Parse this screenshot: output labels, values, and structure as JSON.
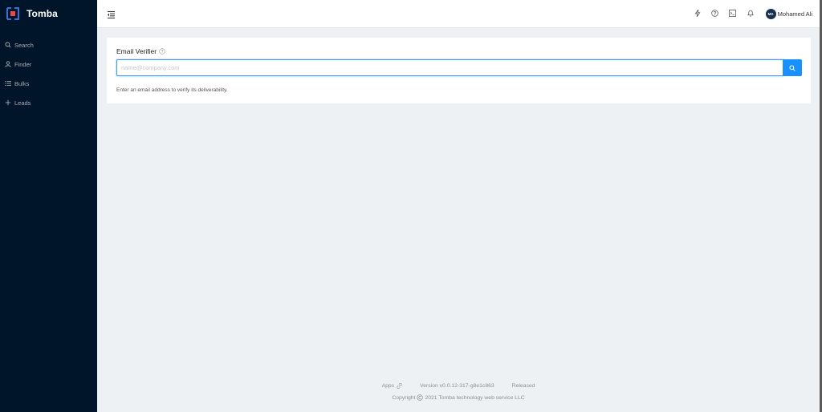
{
  "app": {
    "name": "Tomba"
  },
  "sidebar": {
    "items": [
      {
        "label": "Search",
        "icon": "search-icon"
      },
      {
        "label": "Finder",
        "icon": "user-icon"
      },
      {
        "label": "Bulks",
        "icon": "list-icon"
      },
      {
        "label": "Leads",
        "icon": "plus-icon"
      }
    ]
  },
  "header": {
    "icons": [
      "lightning-icon",
      "question-icon",
      "terminal-icon",
      "bell-icon"
    ],
    "user": {
      "initials": "MA",
      "name": "Mohamed Ali"
    }
  },
  "verifier": {
    "title": "Email Verifier",
    "placeholder": "name@company.com",
    "value": "",
    "hint": "Enter an email address to verify its deliverability."
  },
  "footer": {
    "apps": "Apps",
    "version": "Version v0.0.12-317-g8e1c863",
    "released": "Released",
    "copyright_prefix": "Copyright",
    "copyright_rest": "2021 Tomba technology web service LLC"
  },
  "colors": {
    "sidebar": "#001529",
    "accent": "#1890ff",
    "background": "#eef1f4"
  }
}
